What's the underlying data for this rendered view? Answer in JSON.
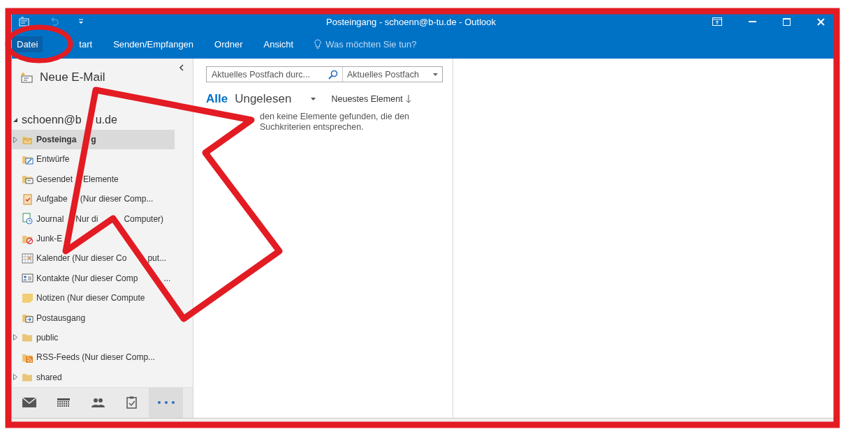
{
  "title_bar": {
    "title": "Posteingang - schoenn@b-tu.de - Outlook"
  },
  "ribbon": {
    "tabs": [
      {
        "label": "Datei",
        "kind": "file"
      },
      {
        "label": "tart",
        "kind": "tab"
      },
      {
        "label": "Senden/Empfangen",
        "kind": "tab"
      },
      {
        "label": "Ordner",
        "kind": "tab"
      },
      {
        "label": "Ansicht",
        "kind": "tab"
      }
    ],
    "tell_me": "Was möchten Sie tun?"
  },
  "folder_pane": {
    "new_mail": "Neue E-Mail",
    "account": [
      "schoenn@b",
      "u.de"
    ],
    "folders": [
      {
        "parts": [
          "Posteinga",
          "g"
        ],
        "kind": "inbox",
        "selected": true,
        "collapsed": true
      },
      {
        "parts": [
          "Entwürfe"
        ],
        "kind": "drafts",
        "selected": false,
        "collapsed": false
      },
      {
        "parts": [
          "Gesendet",
          "Elemente"
        ],
        "kind": "sent",
        "selected": false,
        "collapsed": false
      },
      {
        "parts": [
          "Aufgabe",
          "(Nur dieser Comp..."
        ],
        "kind": "tasks",
        "selected": false,
        "collapsed": false
      },
      {
        "parts": [
          "Journal",
          "Nur di",
          "Computer)"
        ],
        "kind": "journal",
        "selected": false,
        "collapsed": false
      },
      {
        "parts": [
          "Junk-E"
        ],
        "kind": "junk",
        "selected": false,
        "collapsed": false
      },
      {
        "parts": [
          "Kalender (Nur dieser Co",
          "put..."
        ],
        "kind": "calendar",
        "selected": false,
        "collapsed": false
      },
      {
        "parts": [
          "Kontakte (Nur dieser Comp",
          "..."
        ],
        "kind": "contacts",
        "selected": false,
        "collapsed": false
      },
      {
        "parts": [
          "Notizen (Nur dieser Compute"
        ],
        "kind": "notes",
        "selected": false,
        "collapsed": false
      },
      {
        "parts": [
          "Postausgang"
        ],
        "kind": "outbox",
        "selected": false,
        "collapsed": false
      },
      {
        "parts": [
          "public"
        ],
        "kind": "folder",
        "selected": false,
        "collapsed": true
      },
      {
        "parts": [
          "RSS-Feeds (Nur dieser Comp..."
        ],
        "kind": "rss",
        "selected": false,
        "collapsed": false
      },
      {
        "parts": [
          "shared"
        ],
        "kind": "folder",
        "selected": false,
        "collapsed": true
      }
    ],
    "nav": [
      {
        "kind": "mail",
        "selected": false
      },
      {
        "kind": "calendar",
        "selected": false
      },
      {
        "kind": "people",
        "selected": false
      },
      {
        "kind": "tasks",
        "selected": false
      },
      {
        "kind": "more",
        "selected": true
      }
    ]
  },
  "message_list": {
    "search": {
      "placeholder": "Aktuelles Postfach durc..."
    },
    "scope": "Aktuelles Postfach",
    "filters": [
      {
        "label": "Alle",
        "selected": true
      },
      {
        "label": "Ungelesen",
        "selected": false
      }
    ],
    "sort": "Neuestes Element",
    "empty_message": "den keine Elemente gefunden, die den Suchkriterien entsprechen."
  }
}
